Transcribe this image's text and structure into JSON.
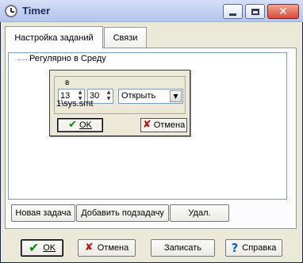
{
  "window": {
    "title": "Timer"
  },
  "tabs": [
    {
      "label": "Настройка заданий",
      "active": true
    },
    {
      "label": "Связи",
      "active": false
    }
  ],
  "tree": {
    "items": [
      {
        "label": "Регулярно в Среду"
      }
    ]
  },
  "editor": {
    "group_label": "в",
    "hour": "13",
    "minute": "30",
    "action": "Открыть",
    "path": "1\\sys.smt",
    "ok_label": "OK",
    "cancel_label": "Отмена"
  },
  "task_buttons": {
    "new_task": "Новая задача",
    "add_subtask": "Добавить подзадачу",
    "delete": "Удал."
  },
  "footer": {
    "ok": "OK",
    "cancel": "Отмена",
    "save": "Записать",
    "help": "Справка"
  },
  "icons": {
    "app": "clock-icon",
    "ok": "checkmark-icon",
    "cancel": "red-x-icon",
    "help": "question-icon"
  },
  "colors": {
    "ok_check": "#0c8a0c",
    "cancel_x": "#bb1111",
    "help_q": "#1561c8"
  }
}
